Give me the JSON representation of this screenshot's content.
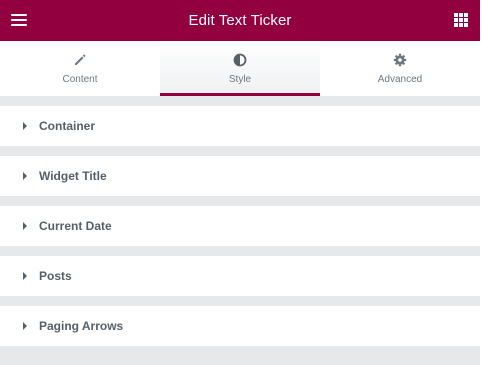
{
  "header": {
    "title": "Edit Text Ticker",
    "menu_icon": "hamburger-icon",
    "apps_icon": "grid-apps-icon",
    "background": "#93003f"
  },
  "tabs": [
    {
      "label": "Content",
      "icon": "pencil-icon",
      "active": false
    },
    {
      "label": "Style",
      "icon": "half-circle-icon",
      "active": true
    },
    {
      "label": "Advanced",
      "icon": "gear-icon",
      "active": false
    }
  ],
  "sections": [
    {
      "label": "Container"
    },
    {
      "label": "Widget Title"
    },
    {
      "label": "Current Date"
    },
    {
      "label": "Posts"
    },
    {
      "label": "Paging Arrows"
    }
  ],
  "colors": {
    "accent": "#93003f",
    "section_text": "#556068",
    "tab_text": "#6d7882",
    "panel_bg": "#e6e8ea"
  }
}
